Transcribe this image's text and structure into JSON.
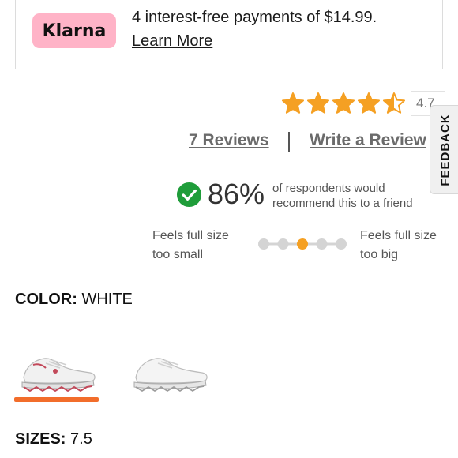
{
  "klarna": {
    "logo_text": "Klarna",
    "message": "4 interest-free payments of $14.99.",
    "learn_more": "Learn More",
    "logo_color": "#ffb3c7"
  },
  "rating": {
    "stars": 4.5,
    "value_label": "4.7",
    "star_color": "#f5a023"
  },
  "reviews": {
    "count_label": "7 Reviews",
    "write_label": "Write a Review"
  },
  "feedback_tab": {
    "label": "FEEDBACK"
  },
  "recommend": {
    "percent": "86%",
    "text": "of respondents would recommend this to a friend",
    "check_color": "#1f9d3a"
  },
  "fit": {
    "left_label": "Feels full size too small",
    "right_label": "Feels full size too big",
    "steps": 5,
    "selected_step": 3,
    "selected_color": "#f5a023",
    "inactive_color": "#d4d4d4"
  },
  "color": {
    "label": "COLOR:",
    "value": "WHITE",
    "swatches": [
      "white-pink-shoe",
      "white-shoe"
    ],
    "selected_index": 0,
    "underline_color": "#f26d2b"
  },
  "sizes": {
    "label": "SIZES:",
    "value": "7.5"
  }
}
